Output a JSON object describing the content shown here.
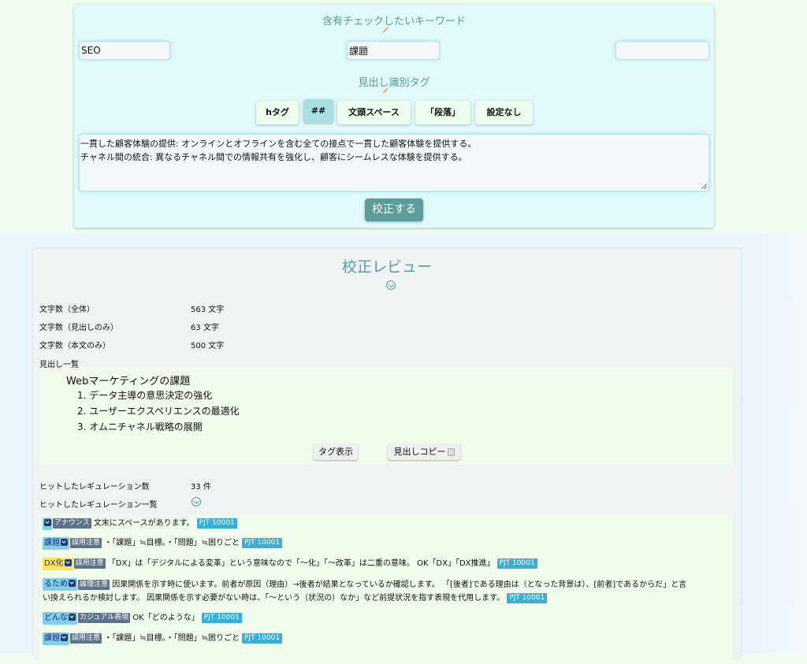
{
  "keywords_section": {
    "title": "含有チェックしたいキーワード",
    "inputs": [
      "SEO",
      "課題",
      ""
    ]
  },
  "heading_tag_section": {
    "title": "見出し識別タグ",
    "buttons": [
      "hタグ",
      "##",
      "文頭スペース",
      "「段落」",
      "設定なし"
    ],
    "active_index": 1
  },
  "input_text": {
    "line1": "一貫した顧客体験の提供: オンラインとオフラインを含む全ての接点で一貫した顧客体験を提供する。",
    "line2": "チャネル間の統合: 異なるチャネル間での情報共有を強化し、顧客にシームレスな体験を提供する。"
  },
  "submit_label": "校正する",
  "review": {
    "title": "校正レビュー",
    "stats": [
      {
        "label": "文字数（全体）",
        "value": "563 文字"
      },
      {
        "label": "文字数（見出しのみ）",
        "value": "63 文字"
      },
      {
        "label": "文字数（本文のみ）",
        "value": "500 文字"
      }
    ],
    "headings_label": "見出し一覧",
    "headings": {
      "main": "Webマーケティングの課題",
      "subs": [
        "1. データ主導の意思決定の強化",
        "2. ユーザーエクスペリエンスの最適化",
        "3. オムニチャネル戦略の展開"
      ]
    },
    "tag_show_label": "タグ表示",
    "copy_label": "見出しコピー",
    "hit_count_label": "ヒットしたレギュレーション数",
    "hit_count_value": "33 件",
    "hit_list_label": "ヒットしたレギュレーション一覧"
  },
  "regulations": [
    {
      "word": "",
      "category": "アナウンス",
      "message": "文末にスペースがあります。",
      "code": "PJT 10001"
    },
    {
      "word": "課題",
      "category": "誤用注意",
      "message": "・「課題」≒目標。・「問題」≒困りごと",
      "code": "PJT 10001"
    },
    {
      "word": "DX化",
      "category": "誤用注意",
      "message": "「DX」は「デジタルによる変革」という意味なので「〜化」「〜改革」は二重の意味。 OK「DX」「DX推進」",
      "code": "PJT 10001"
    },
    {
      "word": "るため",
      "category": "論理注意",
      "message": "因果関係を示す時に使います。前者が原因（理由）→後者が結果となっているか確認します。 「[後者]である理由は（となった背景は）、[前者]であるからだ」と言",
      "message2": "い換えられるか検討します。 因果関係を示す必要がない時は、「〜という（状況の）なか」など前提状況を指す表現を代用します。",
      "code": "PJT 10001"
    },
    {
      "word": "どんな",
      "category": "カジュアル表現",
      "message": "OK「どのような」",
      "code": "PJT 10001"
    },
    {
      "word": "課題",
      "category": "誤用注意",
      "message": "・「課題」≒目標。・「問題」≒困りごと",
      "code": "PJT 10001"
    }
  ]
}
